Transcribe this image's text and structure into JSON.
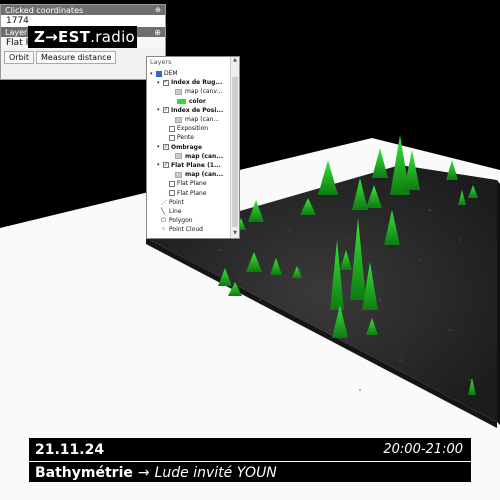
{
  "info_panel": {
    "clicked_title": "Clicked coordinates",
    "coords_value": "1774",
    "layer_header": "Layer",
    "layer_value": "Flat Plane (100)",
    "buttons": [
      "Orbit",
      "Measure distance"
    ]
  },
  "logo": {
    "main": "Z→EST",
    "suffix": ".radio"
  },
  "layers_window": {
    "title": "Layers",
    "items": [
      {
        "label": "DEM",
        "kind": "root"
      },
      {
        "label": "Index de Rug...",
        "kind": "group",
        "checked": true
      },
      {
        "label": "map (canv...",
        "kind": "map"
      },
      {
        "label": "color",
        "kind": "swatch"
      },
      {
        "label": "Index de Posi...",
        "kind": "group",
        "checked": true
      },
      {
        "label": "map (can...",
        "kind": "map"
      },
      {
        "label": "Exposition",
        "kind": "leaf",
        "checked": false
      },
      {
        "label": "Pente",
        "kind": "leaf",
        "checked": false
      },
      {
        "label": "Ombrage",
        "kind": "group",
        "checked": true
      },
      {
        "label": "map (can...",
        "kind": "map"
      },
      {
        "label": "Flat Plane (1...",
        "kind": "group",
        "checked": true
      },
      {
        "label": "map (can...",
        "kind": "map"
      },
      {
        "label": "Flat Plane",
        "kind": "leaf",
        "checked": false
      },
      {
        "label": "Flat Plane",
        "kind": "leaf",
        "checked": false
      },
      {
        "label": "Point",
        "kind": "tool"
      },
      {
        "label": "Line",
        "kind": "tool"
      },
      {
        "label": "Polygon",
        "kind": "tool"
      },
      {
        "label": "Point Cloud",
        "kind": "tool"
      }
    ]
  },
  "banner": {
    "date": "21.11.24",
    "time": "20:00-21:00",
    "title": "Bathymétrie",
    "arrow": "→",
    "subtitle": "Lude invité YOUN"
  },
  "colors": {
    "accent_green": "#2ee02e",
    "background": "#000000",
    "plane": "#ffffff"
  }
}
